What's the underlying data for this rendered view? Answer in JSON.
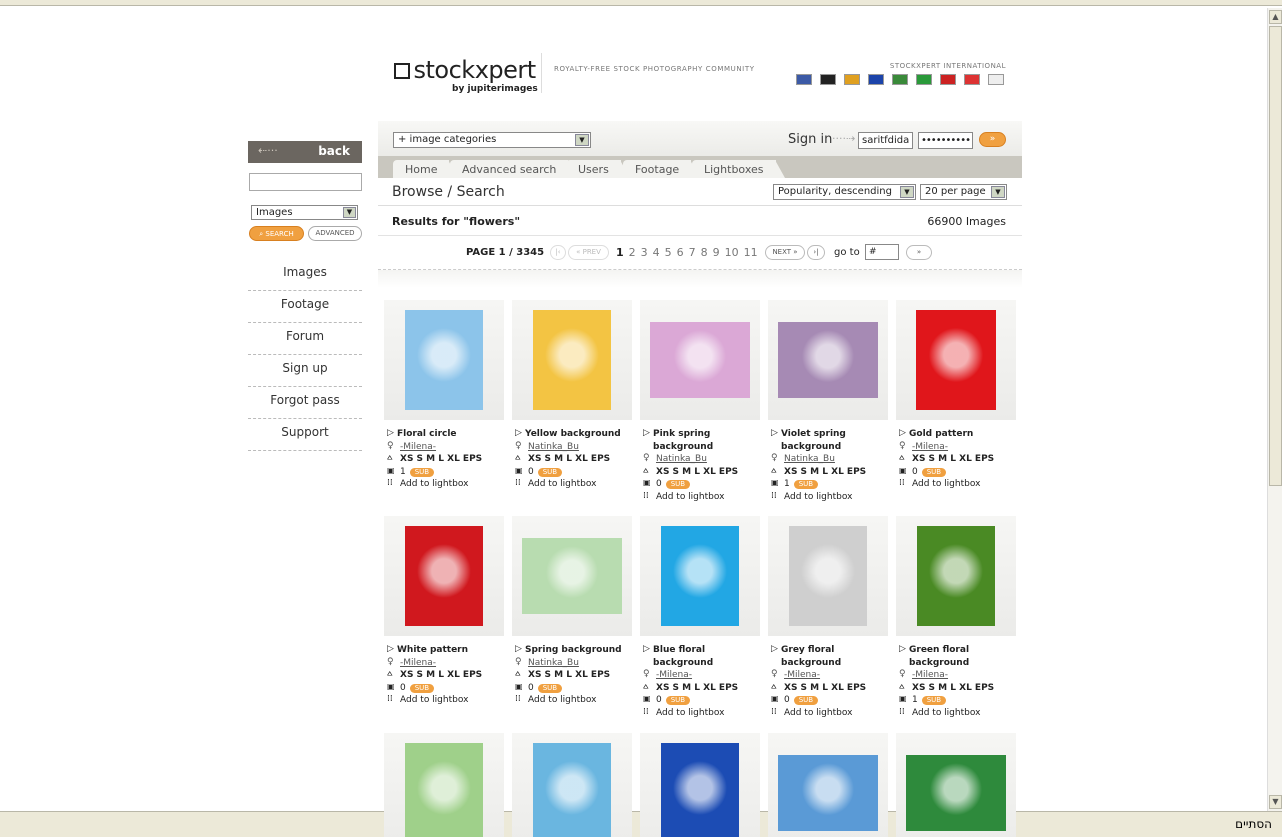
{
  "browser": {
    "status_text": "הסתיים"
  },
  "header": {
    "logo_text": "stockxpert",
    "logo_sub": "by jupiterimages",
    "tagline": "ROYALTY-FREE STOCK PHOTOGRAPHY COMMUNITY",
    "intl_label": "STOCKXPERT INTERNATIONAL",
    "flag_colors": [
      "#3c5aa6",
      "#222",
      "#e0a020",
      "#1c44aa",
      "#3a8a3a",
      "#2a9a3a",
      "#c22",
      "#d33",
      "#eee"
    ]
  },
  "sidebar": {
    "back_label": "back",
    "search_value": "",
    "type_select": "Images",
    "search_button": "SEARCH",
    "advanced_button": "ADVANCED",
    "nav": [
      "Images",
      "Footage",
      "Forum",
      "Sign up",
      "Forgot pass",
      "Support"
    ]
  },
  "topbar": {
    "category_select": "+ image categories",
    "signin_label": "Sign in",
    "username": "saritfdida",
    "password": "••••••••••",
    "go_label": "»"
  },
  "tabs": [
    "Home",
    "Advanced search",
    "Users",
    "Footage",
    "Lightboxes"
  ],
  "browse": {
    "title": "Browse / Search",
    "sort": "Popularity, descending",
    "per_page": "20 per page"
  },
  "results": {
    "query_label": "Results for \"flowers\"",
    "count_label": "66900 Images"
  },
  "pager": {
    "page_label": "PAGE 1 / 3345",
    "first": "|‹",
    "prev": "« PREV",
    "pages": [
      "1",
      "2",
      "3",
      "4",
      "5",
      "6",
      "7",
      "8",
      "9",
      "10",
      "11"
    ],
    "next": "NEXT »",
    "last": "›|",
    "goto_label": "go to",
    "goto_value": "#",
    "goto_btn": "»"
  },
  "items": [
    {
      "title": "Floral circle",
      "author": "-Milena-",
      "sizes": "XS S M L XL EPS",
      "downloads": "1",
      "sub": "SUB",
      "lightbox": "Add to lightbox",
      "color": "#8cc4ea",
      "shape": "tall"
    },
    {
      "title": "Yellow background",
      "author": "Natinka_Bu",
      "sizes": "XS S M L XL EPS",
      "downloads": "0",
      "sub": "SUB",
      "lightbox": "Add to lightbox",
      "color": "#f3c443",
      "shape": "tall"
    },
    {
      "title": "Pink spring background",
      "author": "Natinka_Bu",
      "sizes": "XS S M L XL EPS",
      "downloads": "0",
      "sub": "SUB",
      "lightbox": "Add to lightbox",
      "color": "#dba8d6",
      "shape": "wide"
    },
    {
      "title": "Violet spring background",
      "author": "Natinka_Bu",
      "sizes": "XS S M L XL EPS",
      "downloads": "1",
      "sub": "SUB",
      "lightbox": "Add to lightbox",
      "color": "#a68ab4",
      "shape": "wide"
    },
    {
      "title": "Gold pattern",
      "author": "-Milena-",
      "sizes": "XS S M L XL EPS",
      "downloads": "0",
      "sub": "SUB",
      "lightbox": "Add to lightbox",
      "color": "#e0161b",
      "shape": "square"
    },
    {
      "title": "White pattern",
      "author": "-Milena-",
      "sizes": "XS S M L XL EPS",
      "downloads": "0",
      "sub": "SUB",
      "lightbox": "Add to lightbox",
      "color": "#d0181e",
      "shape": "tall"
    },
    {
      "title": "Spring background",
      "author": "Natinka_Bu",
      "sizes": "XS S M L XL EPS",
      "downloads": "0",
      "sub": "SUB",
      "lightbox": "Add to lightbox",
      "color": "#b8dcb0",
      "shape": "wide"
    },
    {
      "title": "Blue floral background",
      "author": "-Milena-",
      "sizes": "XS S M L XL EPS",
      "downloads": "0",
      "sub": "SUB",
      "lightbox": "Add to lightbox",
      "color": "#22a7e4",
      "shape": "tall2"
    },
    {
      "title": "Grey floral background",
      "author": "-Milena-",
      "sizes": "XS S M L XL EPS",
      "downloads": "0",
      "sub": "SUB",
      "lightbox": "Add to lightbox",
      "color": "#cfcfcf",
      "shape": "tall2"
    },
    {
      "title": "Green floral background",
      "author": "-Milena-",
      "sizes": "XS S M L XL EPS",
      "downloads": "1",
      "sub": "SUB",
      "lightbox": "Add to lightbox",
      "color": "#4a8a24",
      "shape": "tall"
    },
    {
      "color": "#9fd08a",
      "shape": "tall"
    },
    {
      "color": "#6ab6e0",
      "shape": "tall"
    },
    {
      "color": "#1c4cb4",
      "shape": "tall"
    },
    {
      "color": "#5a9ad6",
      "shape": "wide"
    },
    {
      "color": "#2e8a3c",
      "shape": "wide"
    }
  ]
}
